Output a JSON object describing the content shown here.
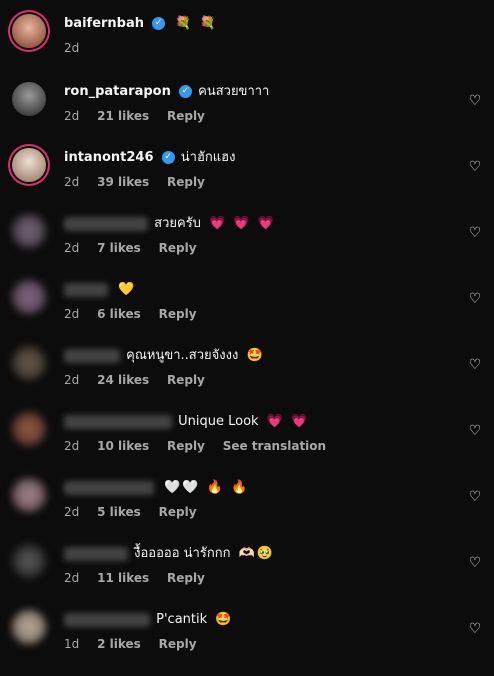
{
  "comments": [
    {
      "username": "baifernbah",
      "verified": true,
      "text": "",
      "emojis": "💐 💐",
      "time": "2d",
      "likes": "",
      "reply": "",
      "translate": "",
      "blur": false
    },
    {
      "username": "ron_patarapon",
      "verified": true,
      "text": "คนสวยขาาา",
      "emojis": "",
      "time": "2d",
      "likes": "21 likes",
      "reply": "Reply",
      "translate": "",
      "blur": false
    },
    {
      "username": "intanont246",
      "verified": true,
      "text": "น่าฮักแฮง",
      "emojis": "",
      "time": "2d",
      "likes": "39 likes",
      "reply": "Reply",
      "translate": "",
      "blur": false
    },
    {
      "username": "",
      "verified": false,
      "text": "สวยครับ",
      "emojis": "💗 💗 💗",
      "time": "2d",
      "likes": "7 likes",
      "reply": "Reply",
      "translate": "",
      "blur": true
    },
    {
      "username": "",
      "verified": false,
      "text": "",
      "emojis": "💛",
      "time": "2d",
      "likes": "6 likes",
      "reply": "Reply",
      "translate": "",
      "blur": true
    },
    {
      "username": "",
      "verified": false,
      "text": "คุณหนูขา..สวยจังงง",
      "emojis": "🤩",
      "time": "2d",
      "likes": "24 likes",
      "reply": "Reply",
      "translate": "",
      "blur": true
    },
    {
      "username": "",
      "verified": false,
      "text": "Unique Look",
      "emojis": "💗 💗",
      "time": "2d",
      "likes": "10 likes",
      "reply": "Reply",
      "translate": "See translation",
      "blur": true
    },
    {
      "username": "",
      "verified": false,
      "text": "",
      "emojis": "🤍🤍 🔥 🔥",
      "time": "2d",
      "likes": "5 likes",
      "reply": "Reply",
      "translate": "",
      "blur": true
    },
    {
      "username": "",
      "verified": false,
      "text": "งื้อออออ น่ารักกก",
      "emojis": "🫶🏻🥹",
      "time": "2d",
      "likes": "11 likes",
      "reply": "Reply",
      "translate": "",
      "blur": true
    },
    {
      "username": "",
      "verified": false,
      "text": "P'cantik",
      "emojis": "🤩",
      "time": "1d",
      "likes": "2 likes",
      "reply": "Reply",
      "translate": "",
      "blur": true
    }
  ],
  "colors": {
    "background": "#0c0c0c",
    "text": "#f5f5f5",
    "secondary": "#a8a8a8",
    "verified": "#3897f0"
  },
  "icons": {
    "heart": "♡",
    "verified": "✓"
  }
}
